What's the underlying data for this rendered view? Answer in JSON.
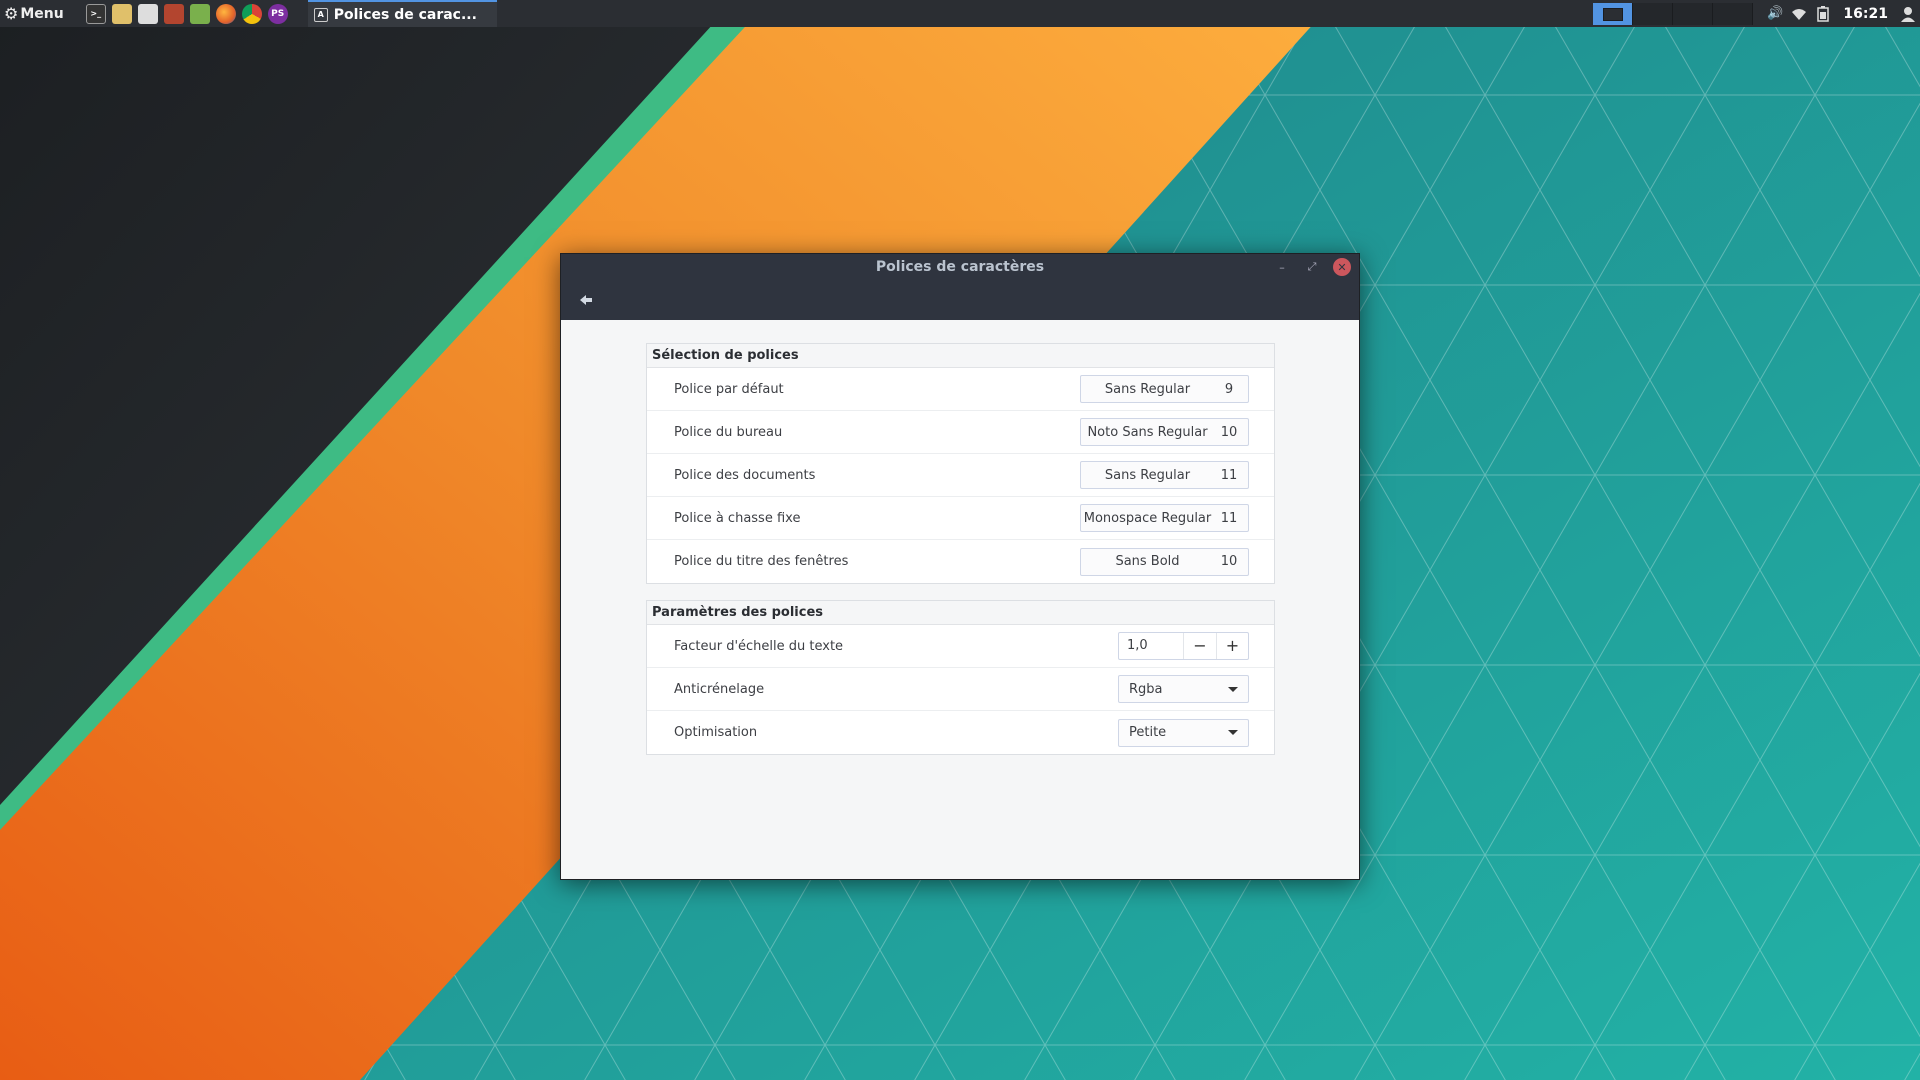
{
  "panel": {
    "menu_label": "Menu",
    "launchers": [
      {
        "name": "terminal-launcher-icon",
        "glyph": ">_"
      },
      {
        "name": "files-launcher-icon",
        "glyph": ""
      },
      {
        "name": "calculator-launcher-icon",
        "glyph": ""
      },
      {
        "name": "archive-launcher-icon",
        "glyph": ""
      },
      {
        "name": "software-launcher-icon",
        "glyph": ""
      },
      {
        "name": "firefox-launcher-icon",
        "glyph": ""
      },
      {
        "name": "chrome-launcher-icon",
        "glyph": ""
      },
      {
        "name": "ps-launcher-icon",
        "glyph": "PS"
      }
    ],
    "task_title": "Polices de carac...",
    "clock": "16:21",
    "accent_color": "#5294e2"
  },
  "window": {
    "title": "Polices de caractères",
    "sections": {
      "selection": {
        "heading": "Sélection de polices",
        "rows": [
          {
            "label": "Police par défaut",
            "font": "Sans Regular",
            "size": "9"
          },
          {
            "label": "Police du bureau",
            "font": "Noto Sans Regular",
            "size": "10"
          },
          {
            "label": "Police des documents",
            "font": "Sans Regular",
            "size": "11"
          },
          {
            "label": "Police à chasse fixe",
            "font": "Monospace Regular",
            "size": "11"
          },
          {
            "label": "Police du titre des fenêtres",
            "font": "Sans Bold",
            "size": "10"
          }
        ]
      },
      "params": {
        "heading": "Paramètres des polices",
        "scale": {
          "label": "Facteur d'échelle du texte",
          "value": "1,0",
          "minus": "−",
          "plus": "+"
        },
        "antialias": {
          "label": "Anticrénelage",
          "value": "Rgba"
        },
        "hinting": {
          "label": "Optimisation",
          "value": "Petite"
        }
      }
    }
  }
}
